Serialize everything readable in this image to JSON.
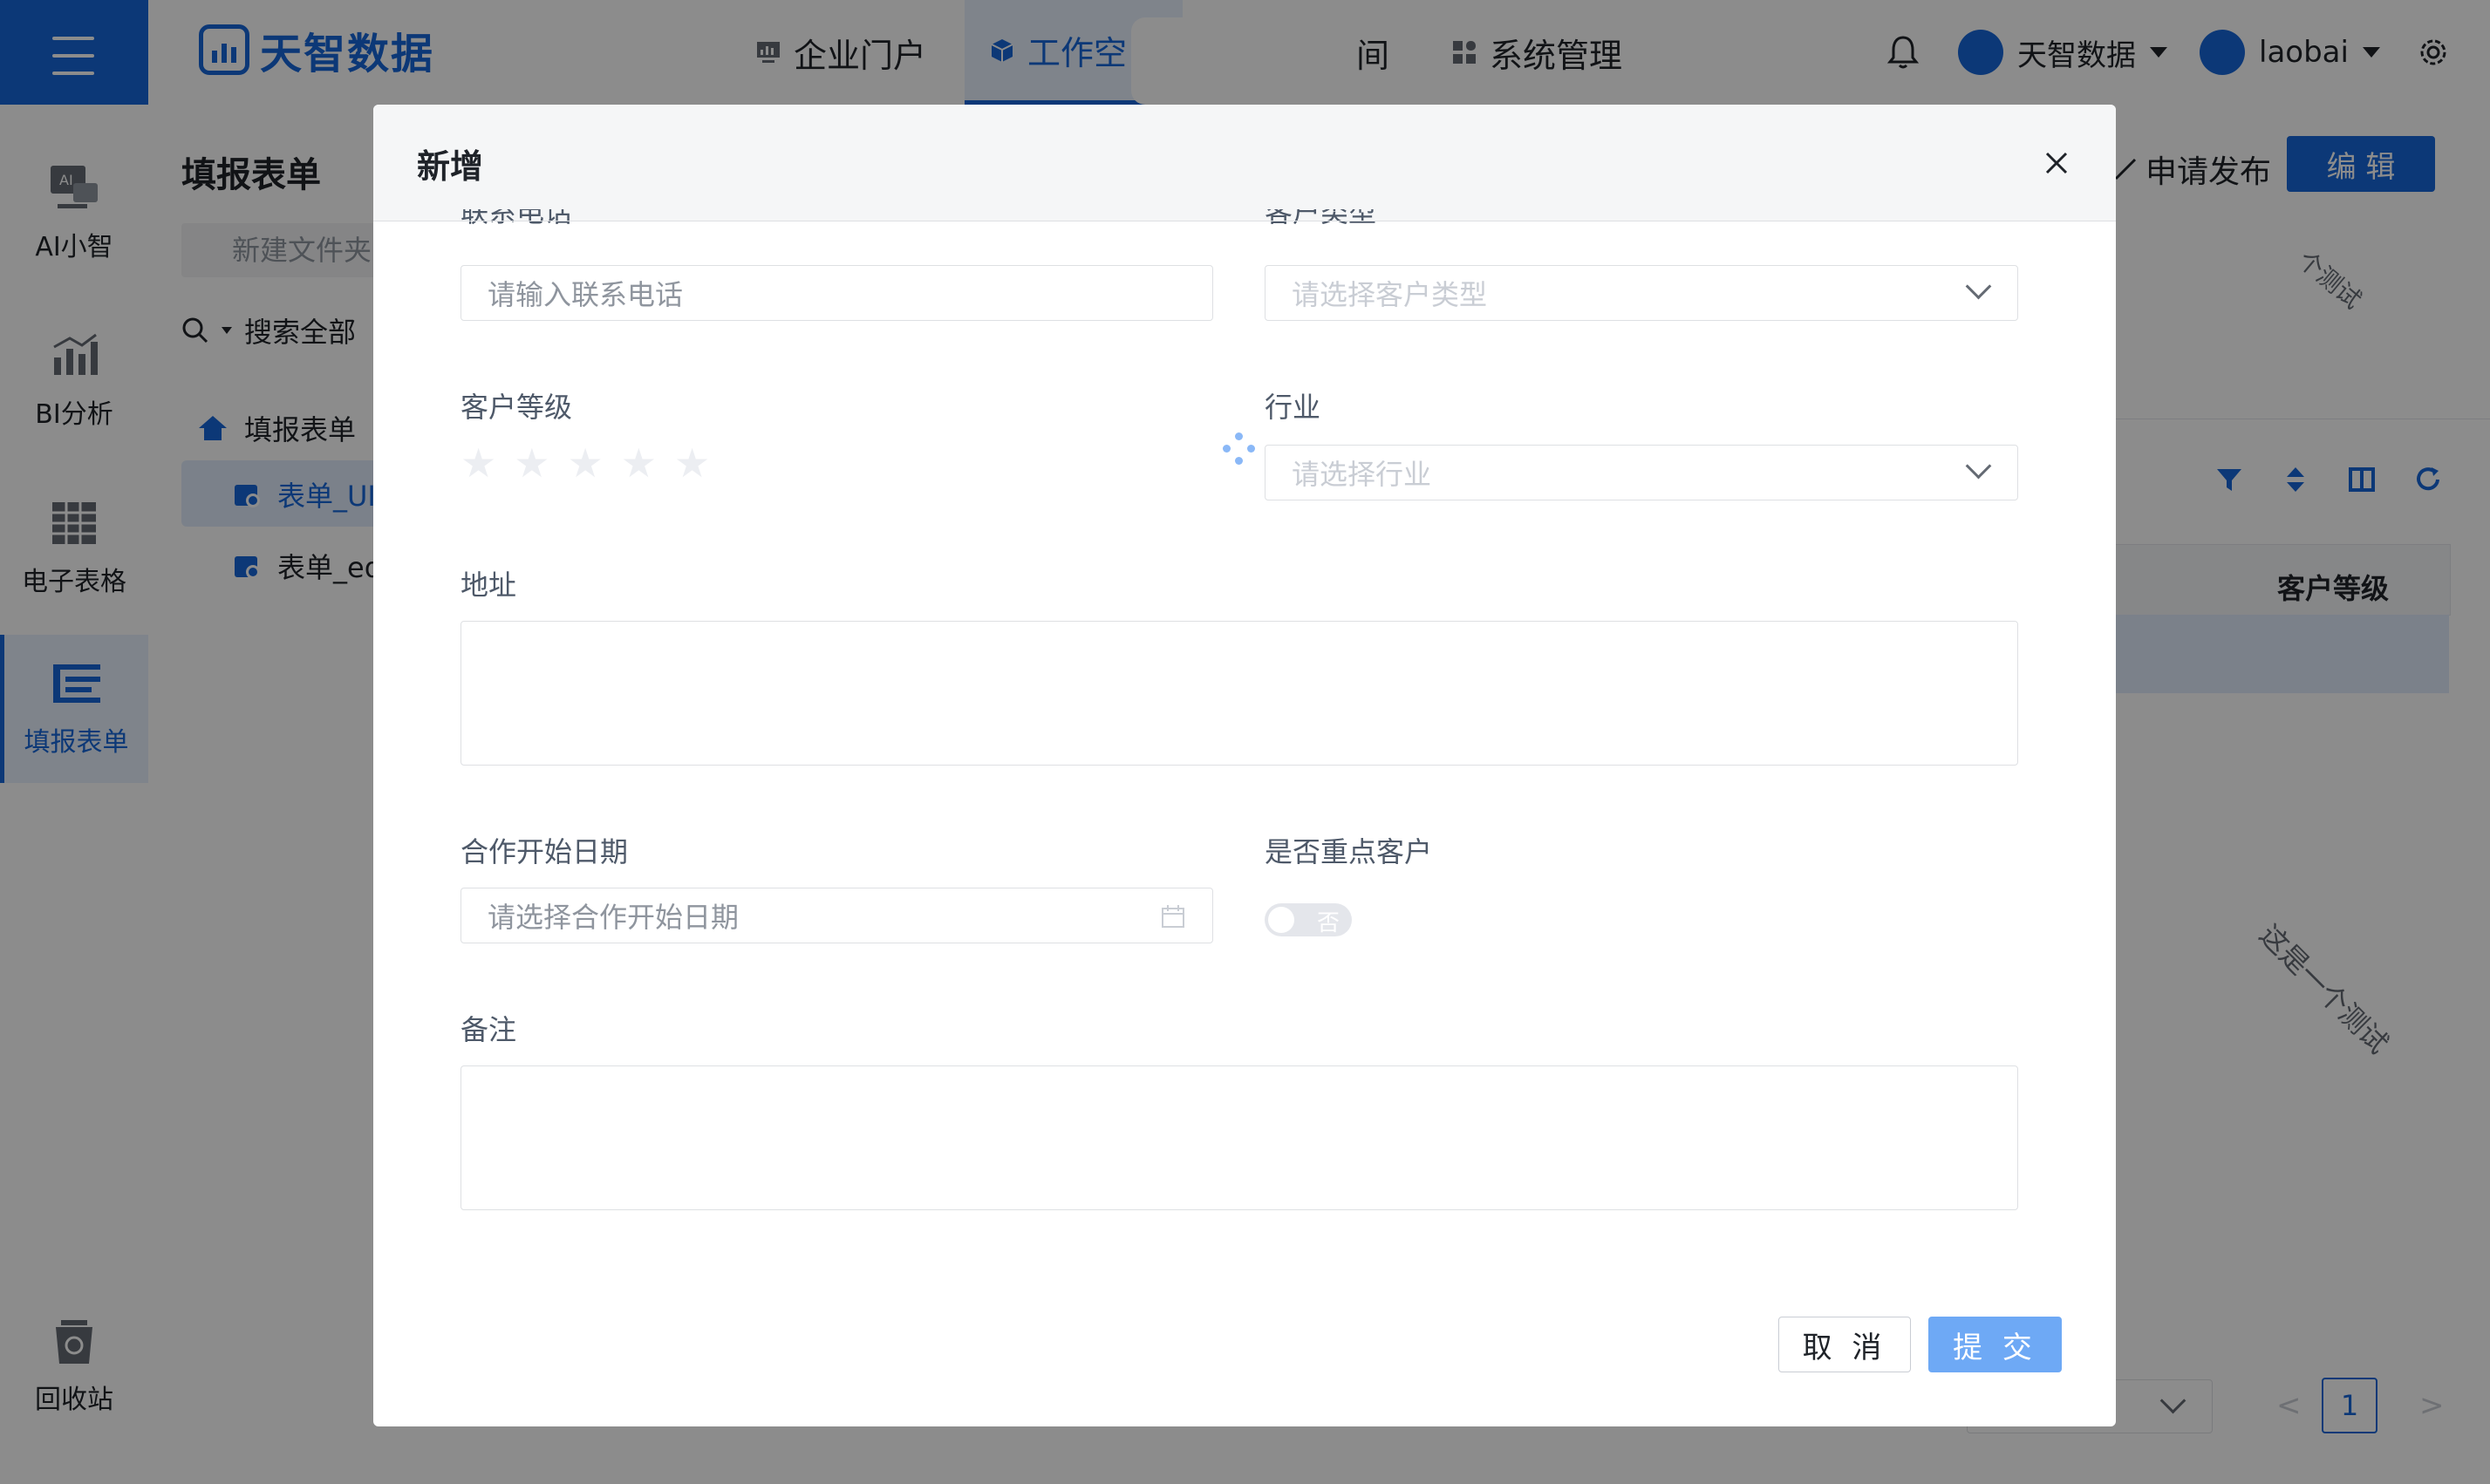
{
  "brand": {
    "name": "天智数据",
    "color": "#1767d9"
  },
  "nav": [
    {
      "label": "企业门户",
      "icon": "dashboard-icon"
    },
    {
      "label": "工作空",
      "icon": "cube-icon",
      "active": true
    },
    {
      "label": "间",
      "icon": ""
    },
    {
      "label": "系统管理",
      "icon": "apps-icon"
    }
  ],
  "header": {
    "org_name": "天智数据",
    "user_name": "laobai"
  },
  "rail": [
    {
      "label": "AI小智",
      "icon": "ai-icon"
    },
    {
      "label": "BI分析",
      "icon": "bar-chart-icon"
    },
    {
      "label": "电子表格",
      "icon": "spreadsheet-icon"
    },
    {
      "label": "填报表单",
      "icon": "form-icon",
      "active": true
    },
    {
      "label": "回收站",
      "icon": "recycle-bin-icon"
    }
  ],
  "panel2": {
    "title": "填报表单",
    "new_folder": "新建文件夹",
    "search": "搜索全部",
    "tree_root": "填报表单",
    "tree_items": [
      "表单_UI",
      "表单_ed"
    ]
  },
  "main": {
    "apply_publish": "申请发布",
    "edit": "编 辑",
    "col_customer_level": "客户等级",
    "watermark": "这是一个测试",
    "watermark_short": "个测试",
    "page": "1"
  },
  "modal": {
    "title": "新增",
    "fields": {
      "phone": {
        "label": "联系电话",
        "placeholder": "请输入联系电话"
      },
      "customer_type": {
        "label": "客户类型",
        "placeholder": "请选择客户类型"
      },
      "customer_level": {
        "label": "客户等级",
        "rating": 0,
        "max": 5
      },
      "industry": {
        "label": "行业",
        "placeholder": "请选择行业"
      },
      "address": {
        "label": "地址"
      },
      "start_date": {
        "label": "合作开始日期",
        "placeholder": "请选择合作开始日期"
      },
      "key_customer": {
        "label": "是否重点客户",
        "toggle_text": "否"
      },
      "remarks": {
        "label": "备注"
      }
    },
    "cancel": "取 消",
    "submit": "提 交"
  }
}
